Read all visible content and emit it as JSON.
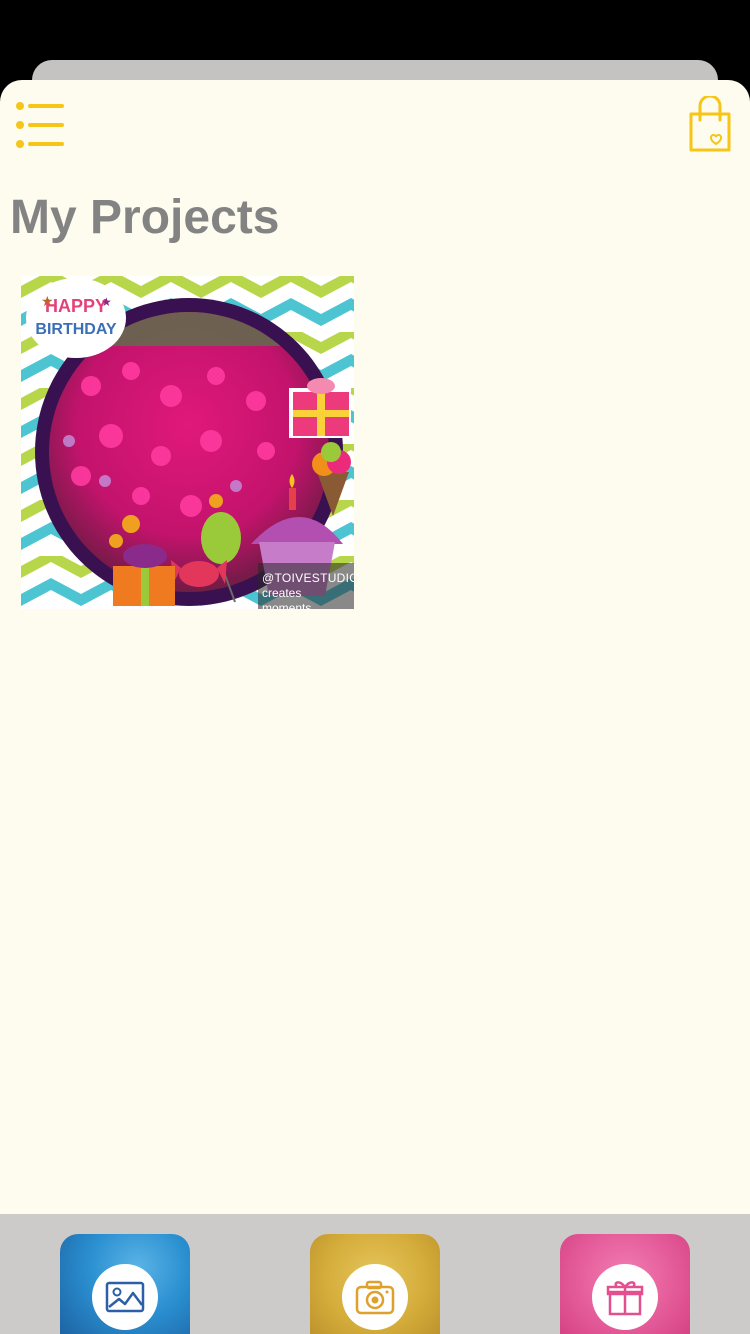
{
  "page": {
    "title": "My Projects"
  },
  "header": {
    "menu_icon": "list-menu-icon",
    "bag_icon": "shopping-bag-icon"
  },
  "projects": [
    {
      "frame_text_line1": "HAPPY",
      "frame_text_line2": "BIRTHDAY",
      "watermark_line1": "@TOIVESTUDIO",
      "watermark_line2": "creates moments"
    }
  ],
  "tabbar": {
    "items": [
      {
        "icon": "photo-gallery-icon"
      },
      {
        "icon": "camera-icon"
      },
      {
        "icon": "gift-icon"
      }
    ]
  },
  "colors": {
    "accent": "#f5c518",
    "background": "#fefcee",
    "title": "#838383",
    "tabbar": "#cdcaca"
  }
}
